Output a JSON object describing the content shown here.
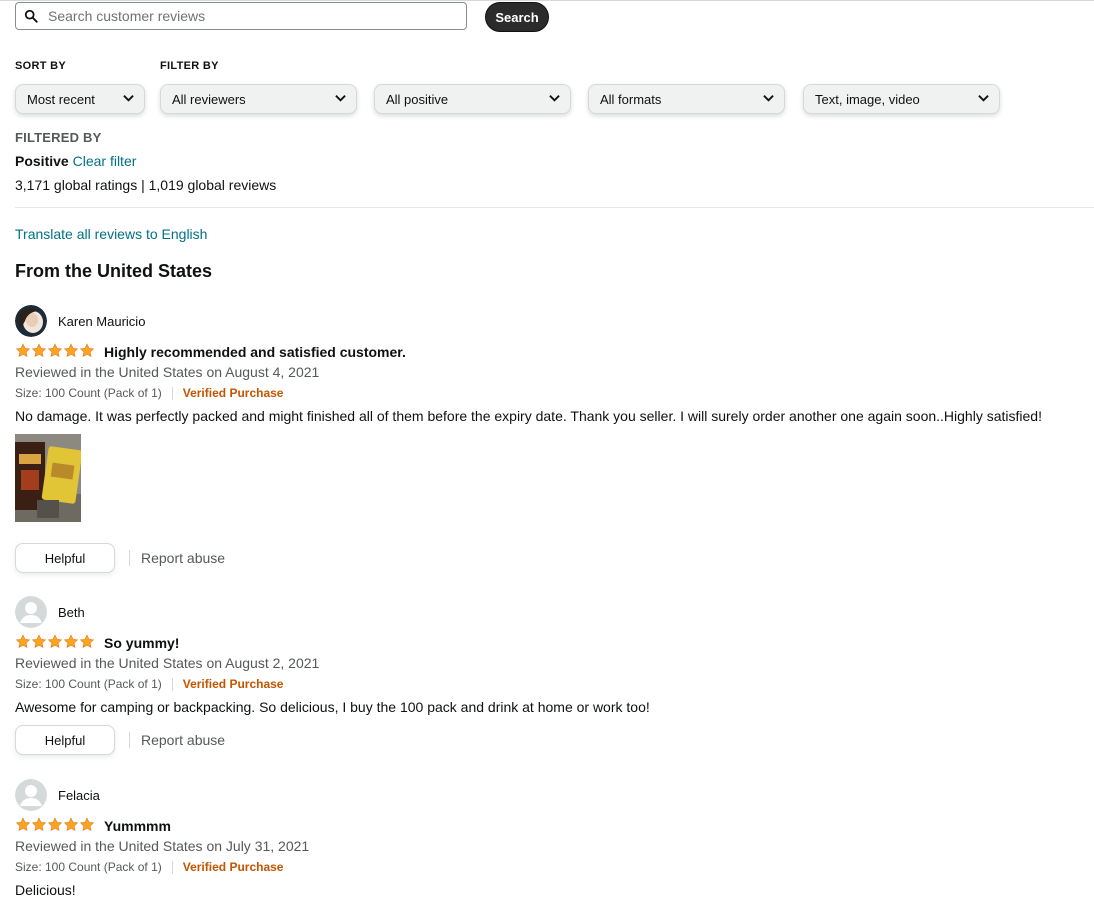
{
  "search": {
    "placeholder": "Search customer reviews",
    "button_label": "Search"
  },
  "sort": {
    "label": "SORT BY",
    "selected": "Most recent"
  },
  "filter": {
    "label": "FILTER BY",
    "reviewers": "All reviewers",
    "stars": "All positive",
    "formats": "All formats",
    "media": "Text, image, video"
  },
  "filtered_by": {
    "label": "FILTERED BY",
    "value": "Positive",
    "clear_label": "Clear filter"
  },
  "totals": "3,171 global ratings | 1,019 global reviews",
  "translate_label": "Translate all reviews to English",
  "section_title": "From the United States",
  "colors": {
    "star": "#ffa41c",
    "link": "#007185",
    "verified": "#c45500"
  },
  "reviews": [
    {
      "name": "Karen Mauricio",
      "rating": 5,
      "title": "Highly recommended and satisfied customer.",
      "date": "Reviewed in the United States on August 4, 2021",
      "size": "Size: 100 Count (Pack of 1)",
      "verified": "Verified Purchase",
      "body": "No damage. It was perfectly packed and might finished all of them before the expiry date. Thank you seller. I will surely order another one again soon..Highly satisfied!",
      "helpful_label": "Helpful",
      "report_label": "Report abuse"
    },
    {
      "name": "Beth",
      "rating": 5,
      "title": "So yummy!",
      "date": "Reviewed in the United States on August 2, 2021",
      "size": "Size: 100 Count (Pack of 1)",
      "verified": "Verified Purchase",
      "body": "Awesome for camping or backpacking. So delicious, I buy the 100 pack and drink at home or work too!",
      "helpful_label": "Helpful",
      "report_label": "Report abuse"
    },
    {
      "name": "Felacia",
      "rating": 5,
      "title": "Yummmm",
      "date": "Reviewed in the United States on July 31, 2021",
      "size": "Size: 100 Count (Pack of 1)",
      "verified": "Verified Purchase",
      "body": "Delicious!"
    }
  ]
}
